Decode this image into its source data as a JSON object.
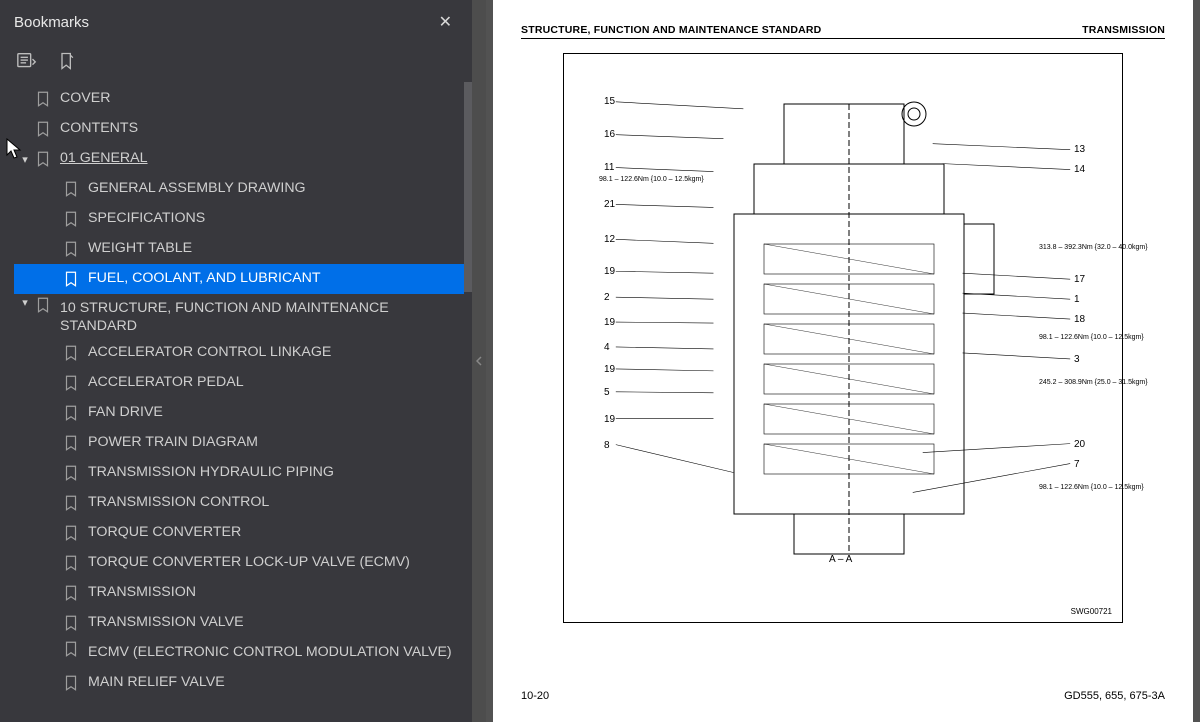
{
  "sidebar": {
    "title": "Bookmarks",
    "bookmarks": [
      {
        "label": "COVER",
        "level": 0
      },
      {
        "label": "CONTENTS",
        "level": 0
      },
      {
        "label": "01 GENERAL",
        "level": 0,
        "expanded": true,
        "underline": true
      },
      {
        "label": "GENERAL ASSEMBLY DRAWING",
        "level": 1
      },
      {
        "label": "SPECIFICATIONS",
        "level": 1
      },
      {
        "label": "WEIGHT TABLE",
        "level": 1
      },
      {
        "label": "FUEL, COOLANT, AND LUBRICANT",
        "level": 1,
        "selected": true
      },
      {
        "label": "10 STRUCTURE, FUNCTION AND MAINTENANCE STANDARD",
        "level": 0,
        "expanded": true
      },
      {
        "label": "ACCELERATOR CONTROL LINKAGE",
        "level": 1
      },
      {
        "label": "ACCELERATOR PEDAL",
        "level": 1
      },
      {
        "label": "FAN DRIVE",
        "level": 1
      },
      {
        "label": "POWER TRAIN DIAGRAM",
        "level": 1
      },
      {
        "label": "TRANSMISSION HYDRAULIC PIPING",
        "level": 1
      },
      {
        "label": "TRANSMISSION CONTROL",
        "level": 1
      },
      {
        "label": "TORQUE CONVERTER",
        "level": 1
      },
      {
        "label": "TORQUE CONVERTER LOCK-UP VALVE (ECMV)",
        "level": 1
      },
      {
        "label": "TRANSMISSION",
        "level": 1
      },
      {
        "label": "TRANSMISSION VALVE",
        "level": 1
      },
      {
        "label": "ECMV (ELECTRONIC CONTROL MODULATION VALVE)",
        "level": 1
      },
      {
        "label": "MAIN RELIEF VALVE",
        "level": 1
      }
    ]
  },
  "page": {
    "header_left": "STRUCTURE, FUNCTION AND MAINTENANCE STANDARD",
    "header_right": "TRANSMISSION",
    "footer_left": "10-20",
    "footer_right": "GD555, 655, 675-3A",
    "diagram_id": "SWG00721",
    "section_label": "A – A",
    "callouts_left": [
      "15",
      "16",
      "11",
      "21",
      "12",
      "19",
      "2",
      "19",
      "4",
      "19",
      "5",
      "19",
      "8"
    ],
    "callouts_right": [
      "13",
      "14",
      "17",
      "1",
      "18",
      "3",
      "20",
      "7"
    ],
    "torque_notes": [
      "98.1 – 122.6Nm  {10.0 – 12.5kgm}",
      "313.8 – 392.3Nm  {32.0 – 40.0kgm}",
      "98.1 – 122.6Nm  {10.0 – 12.5kgm}",
      "245.2 – 308.9Nm  {25.0 – 31.5kgm}",
      "98.1 – 122.6Nm  {10.0 – 12.5kgm}"
    ]
  }
}
